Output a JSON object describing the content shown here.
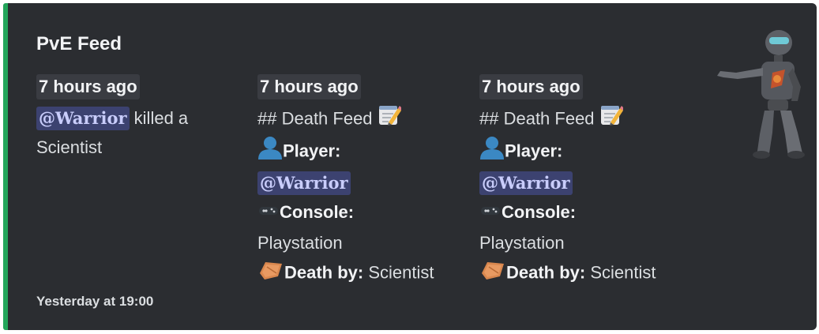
{
  "embed": {
    "accent_color": "#23a55a",
    "title": "PvE Feed",
    "footer": "Yesterday at 19:00",
    "thumbnail_icon": "robot-icon",
    "fields": [
      {
        "name": "7 hours ago",
        "mention": "@Warrior",
        "text_suffix": "killed a",
        "text_line2": "Scientist"
      },
      {
        "name": "7 hours ago",
        "heading": "## Death Feed",
        "heading_icon": "memo-icon",
        "player_label": "Player:",
        "player_icon": "bust-icon",
        "mention": "@Warrior",
        "console_label": "Console:",
        "console_icon": "gamepad-icon",
        "console_value": "Playstation",
        "death_label": "Death by:",
        "death_icon": "coffin-icon",
        "death_value": "Scientist"
      },
      {
        "name": "7 hours ago",
        "heading": "## Death Feed",
        "heading_icon": "memo-icon",
        "player_label": "Player:",
        "player_icon": "bust-icon",
        "mention": "@Warrior",
        "console_label": "Console:",
        "console_icon": "gamepad-icon",
        "console_value": "Playstation",
        "death_label": "Death by:",
        "death_icon": "coffin-icon",
        "death_value": "Scientist"
      }
    ]
  }
}
